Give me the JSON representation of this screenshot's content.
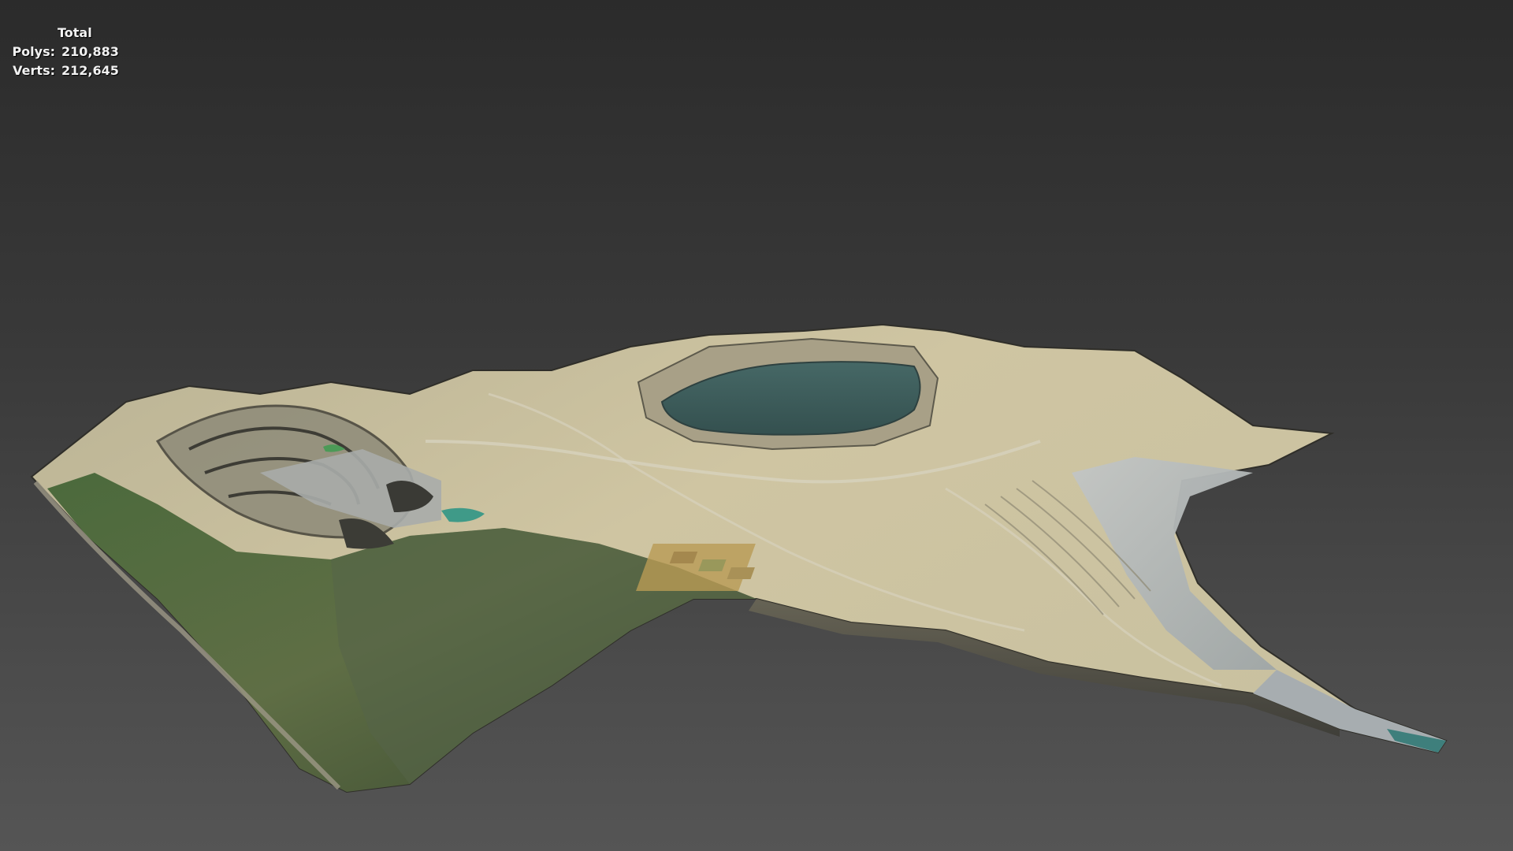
{
  "viewport_stats": {
    "title": "Total",
    "polys_label": "Polys:",
    "polys_value": "210,883",
    "verts_label": "Verts:",
    "verts_value": "212,645"
  },
  "scene": {
    "object": "terrain-mesh-open-pit-mine",
    "colors": {
      "background_top": "#2b2b2b",
      "background_bottom": "#555555",
      "pit_water": "#3d5a5a",
      "forest": "#3e5a34",
      "mine_benches": "#cfc7a6",
      "tailings": "#b8bcbe"
    }
  }
}
